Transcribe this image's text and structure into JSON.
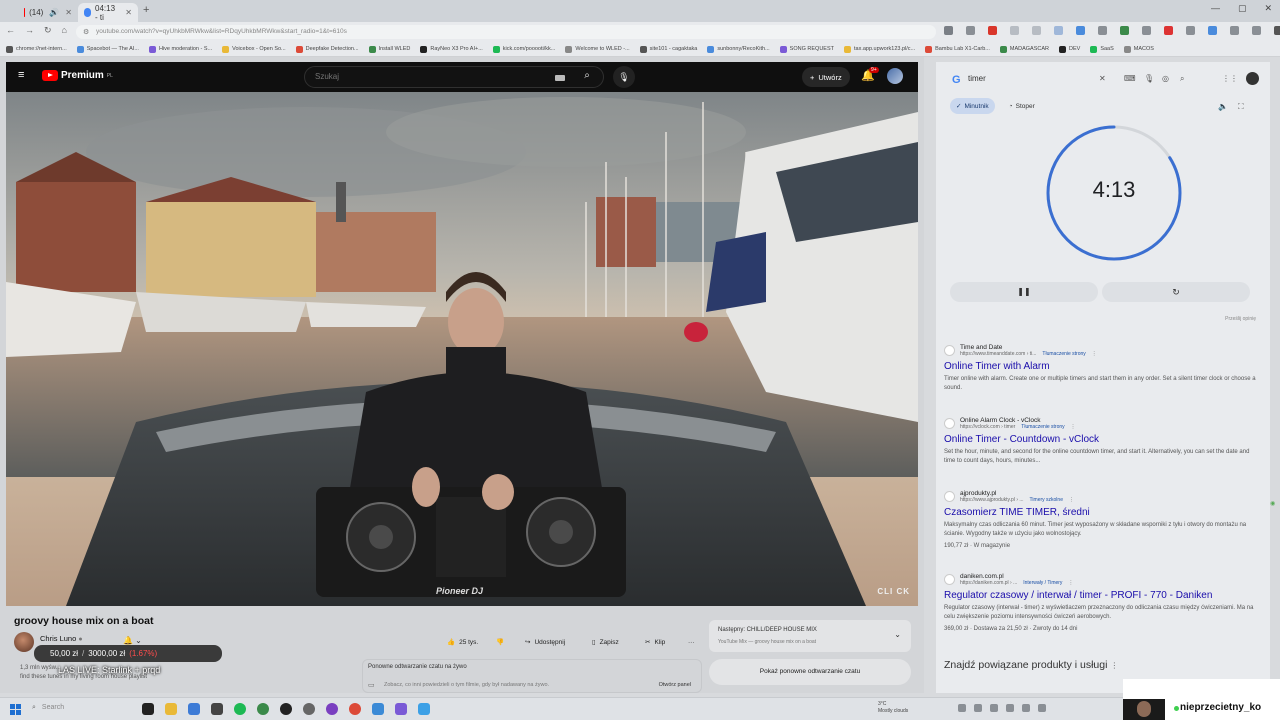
{
  "browser": {
    "tabs": [
      {
        "title": "(14)",
        "active": false
      },
      {
        "title": "04:13 - ti",
        "active": true
      }
    ],
    "url": "youtube.com/watch?v=qyUhkbMRWkw&list=RDqyUhkbMRWkw&start_radio=1&t=610s",
    "bookmarks": [
      "chrome://net-intern...",
      "Spacebot — The AI...",
      "Hive moderation - S...",
      "Voicebox - Open So...",
      "Deepfake Detection...",
      "Install WLED",
      "RayNeo X3 Pro AI+...",
      "kick.com/pooooti/kk...",
      "Welcome to WLED -...",
      "site101 - cagaktaka",
      "sunbonny/RecoKith...",
      "SONG REQUEST",
      "tax.app.upwork123.pl/c...",
      "Bambu Lab X1-Carb...",
      "MADAGASCAR",
      "DEV",
      "SaaS",
      "MACOS"
    ]
  },
  "youtube": {
    "logo": "Premium",
    "logo_sup": "PL",
    "search_placeholder": "Szukaj",
    "create_label": "Utwórz",
    "bell_badge": "9+",
    "video_title": "groovy house mix on a boat",
    "channel_name": "Chris Luno",
    "price_current": "50,00 zł",
    "price_target": "3000,00 zł",
    "price_change": "(1.67%)",
    "live_label": "LAS LIVE: Starlink + prqd",
    "desc_line1": "1,3 mln wyśw...",
    "desc_line2": "find these tunes in my living room house playlist",
    "like_count": "25 tys.",
    "share_label": "Udostępnij",
    "save_label": "Zapisz",
    "clip_label": "Klip",
    "up_next_label": "Następny: CHILL/DEEP HOUSE MIX",
    "up_next_sub": "YouTube Mix — groovy house mix on a boat",
    "replay_header": "Ponowne odtwarzanie czatu na żywo",
    "replay_body": "Zobacz, co inni powiedzieli o tym filmie, gdy był nadawany na żywo.",
    "replay_open": "Otwórz panel",
    "show_replay": "Pokaż ponowne odtwarzanie czatu",
    "video_watermark": "CLI CK",
    "mixer_brand": "Pioneer DJ"
  },
  "google": {
    "query": "timer",
    "tab_timer": "Minutnik",
    "tab_stopwatch": "Stoper",
    "timer_value": "4:13",
    "timer_remaining_fraction": 0.84,
    "feedback": "Prześlij opinię",
    "results": [
      {
        "site": "Time and Date",
        "url": "https://www.timeanddate.com › ti...",
        "translate": "Tłumaczenie strony",
        "title": "Online Timer with Alarm",
        "snippet": "Timer online with alarm. Create one or multiple timers and start them in any order. Set a silent timer clock or choose a sound."
      },
      {
        "site": "Online Alarm Clock - vClock",
        "url": "https://vclock.com › timer",
        "translate": "Tłumaczenie strony",
        "title": "Online Timer - Countdown - vClock",
        "snippet": "Set the hour, minute, and second for the online countdown timer, and start it. Alternatively, you can set the date and time to count days, hours, minutes..."
      },
      {
        "site": "ajprodukty.pl",
        "url": "https://www.ajprodukty.pl › ...",
        "translate": "Timery szkolne",
        "title": "Czasomierz TIME TIMER, średni",
        "snippet": "Maksymalny czas odliczania 60 minut. Timer jest wyposażony w składane wsporniki z tyłu i otwory do montażu na ścianie. Wygodny także w użyciu jako wolnostojący.",
        "meta": "190,77 zł · W magazynie"
      },
      {
        "site": "daniken.com.pl",
        "url": "https://daniken.com.pl › ...",
        "translate": "Interwały / Timery",
        "title": "Regulator czasowy / interwał / timer - PROFI - 770 - Daniken",
        "snippet": "Regulator czasowy (interwał - timer) z wyświetlaczem przeznaczony do odliczania czasu między ćwiczeniami. Ma na celu zwiększenie poziomu intensywności ćwiczeń aerobowych.",
        "meta": "369,00 zł · Dostawa za 21,50 zł · Zwroty do 14 dni"
      }
    ],
    "related": "Znajdź powiązane produkty i usługi"
  },
  "taskbar": {
    "search": "Search",
    "weather_temp": "3°C",
    "weather_desc": "Mostly clouds"
  },
  "overlay": {
    "username": "nieprzecietny_ko"
  }
}
